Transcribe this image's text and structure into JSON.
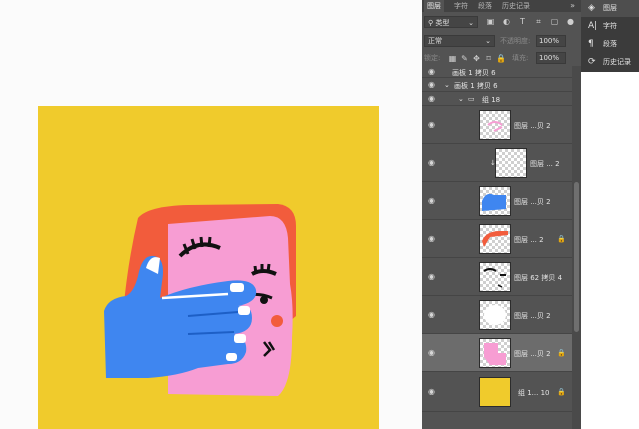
{
  "panel": {
    "tabs": [
      {
        "label": "图层",
        "active": true
      },
      {
        "label": "字符",
        "active": false
      },
      {
        "label": "段落",
        "active": false
      },
      {
        "label": "历史记录",
        "active": false
      }
    ],
    "more_icon": "double-chevron-right-icon",
    "filter": {
      "label": "类型"
    },
    "blend": {
      "mode": "正常",
      "opacity_label": "不透明度:",
      "opacity": "100%"
    },
    "lock": {
      "label": "锁定:",
      "fill_label": "填充:",
      "fill": "100%"
    },
    "layers": [
      {
        "name": "画板 1 拷贝 6",
        "kind": "artboard-header"
      },
      {
        "name": "画板 1 拷贝 6",
        "kind": "artboard"
      },
      {
        "name": "组 18",
        "kind": "group"
      },
      {
        "name": "图层 ...贝 2",
        "thumb": "pink-brush",
        "locked": false
      },
      {
        "name": "图层 ... 2",
        "thumb": "blank",
        "locked": false
      },
      {
        "name": "图层 ...贝 2",
        "thumb": "blue-hand",
        "locked": false
      },
      {
        "name": "图层 ... 2",
        "thumb": "red-hair",
        "locked": true
      },
      {
        "name": "图层 62 拷贝 4",
        "thumb": "face-lines",
        "locked": false
      },
      {
        "name": "图层 ...贝 2",
        "thumb": "white-shape",
        "locked": false
      },
      {
        "name": "图层 ...贝 2",
        "thumb": "pink-shape",
        "locked": true
      },
      {
        "name": "组 1... 10",
        "thumb": "yellow-fill",
        "locked": true
      }
    ]
  },
  "side_panel": {
    "items": [
      {
        "label": "图层",
        "icon": "layers-icon",
        "active": true
      },
      {
        "label": "字符",
        "icon": "character-icon",
        "active": false
      },
      {
        "label": "段落",
        "icon": "paragraph-icon",
        "active": false
      },
      {
        "label": "历史记录",
        "icon": "history-icon",
        "active": false
      }
    ]
  },
  "colors": {
    "artboard_background": "#F0CB2C",
    "hand": "#3F86F0",
    "face": "#F79DD3",
    "hair": "#F25C3C",
    "panel": "#535353"
  }
}
